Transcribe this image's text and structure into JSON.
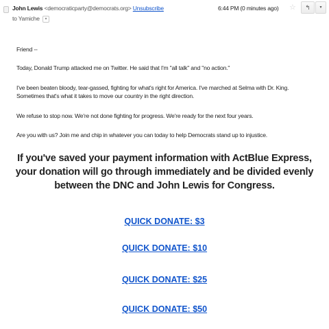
{
  "header": {
    "sender_name": "John Lewis",
    "sender_email": "<democraticparty@democrats.org>",
    "unsubscribe": "Unsubscribe",
    "to_label": "to Yamiche",
    "to_caret": "▾",
    "timestamp": "6:44 PM (0 minutes ago)",
    "star": "☆",
    "reply": "↰",
    "more": "▾"
  },
  "body": {
    "greeting": "Friend --",
    "p1": "Today, Donald Trump attacked me on Twitter. He said that I'm \"all talk\" and \"no action.\"",
    "p2": "I've been beaten bloody, tear-gassed, fighting for what's right for America. I've marched at Selma with Dr. King. Sometimes that's what it takes to move our country in the right direction.",
    "p3": "We refuse to stop now. We're not done fighting for progress. We're ready for the next four years.",
    "p4": "Are you with us? Join me and chip in whatever you can today to help Democrats stand up to injustice.",
    "headline": "If you've saved your payment information with ActBlue Express, your donation will go through immediately and be divided evenly between the DNC and John Lewis for Congress."
  },
  "donate_links": [
    "QUICK DONATE: $3",
    "QUICK DONATE: $10",
    "QUICK DONATE: $25",
    "QUICK DONATE: $50"
  ],
  "colors": {
    "link": "#1155cc",
    "text": "#222222"
  }
}
